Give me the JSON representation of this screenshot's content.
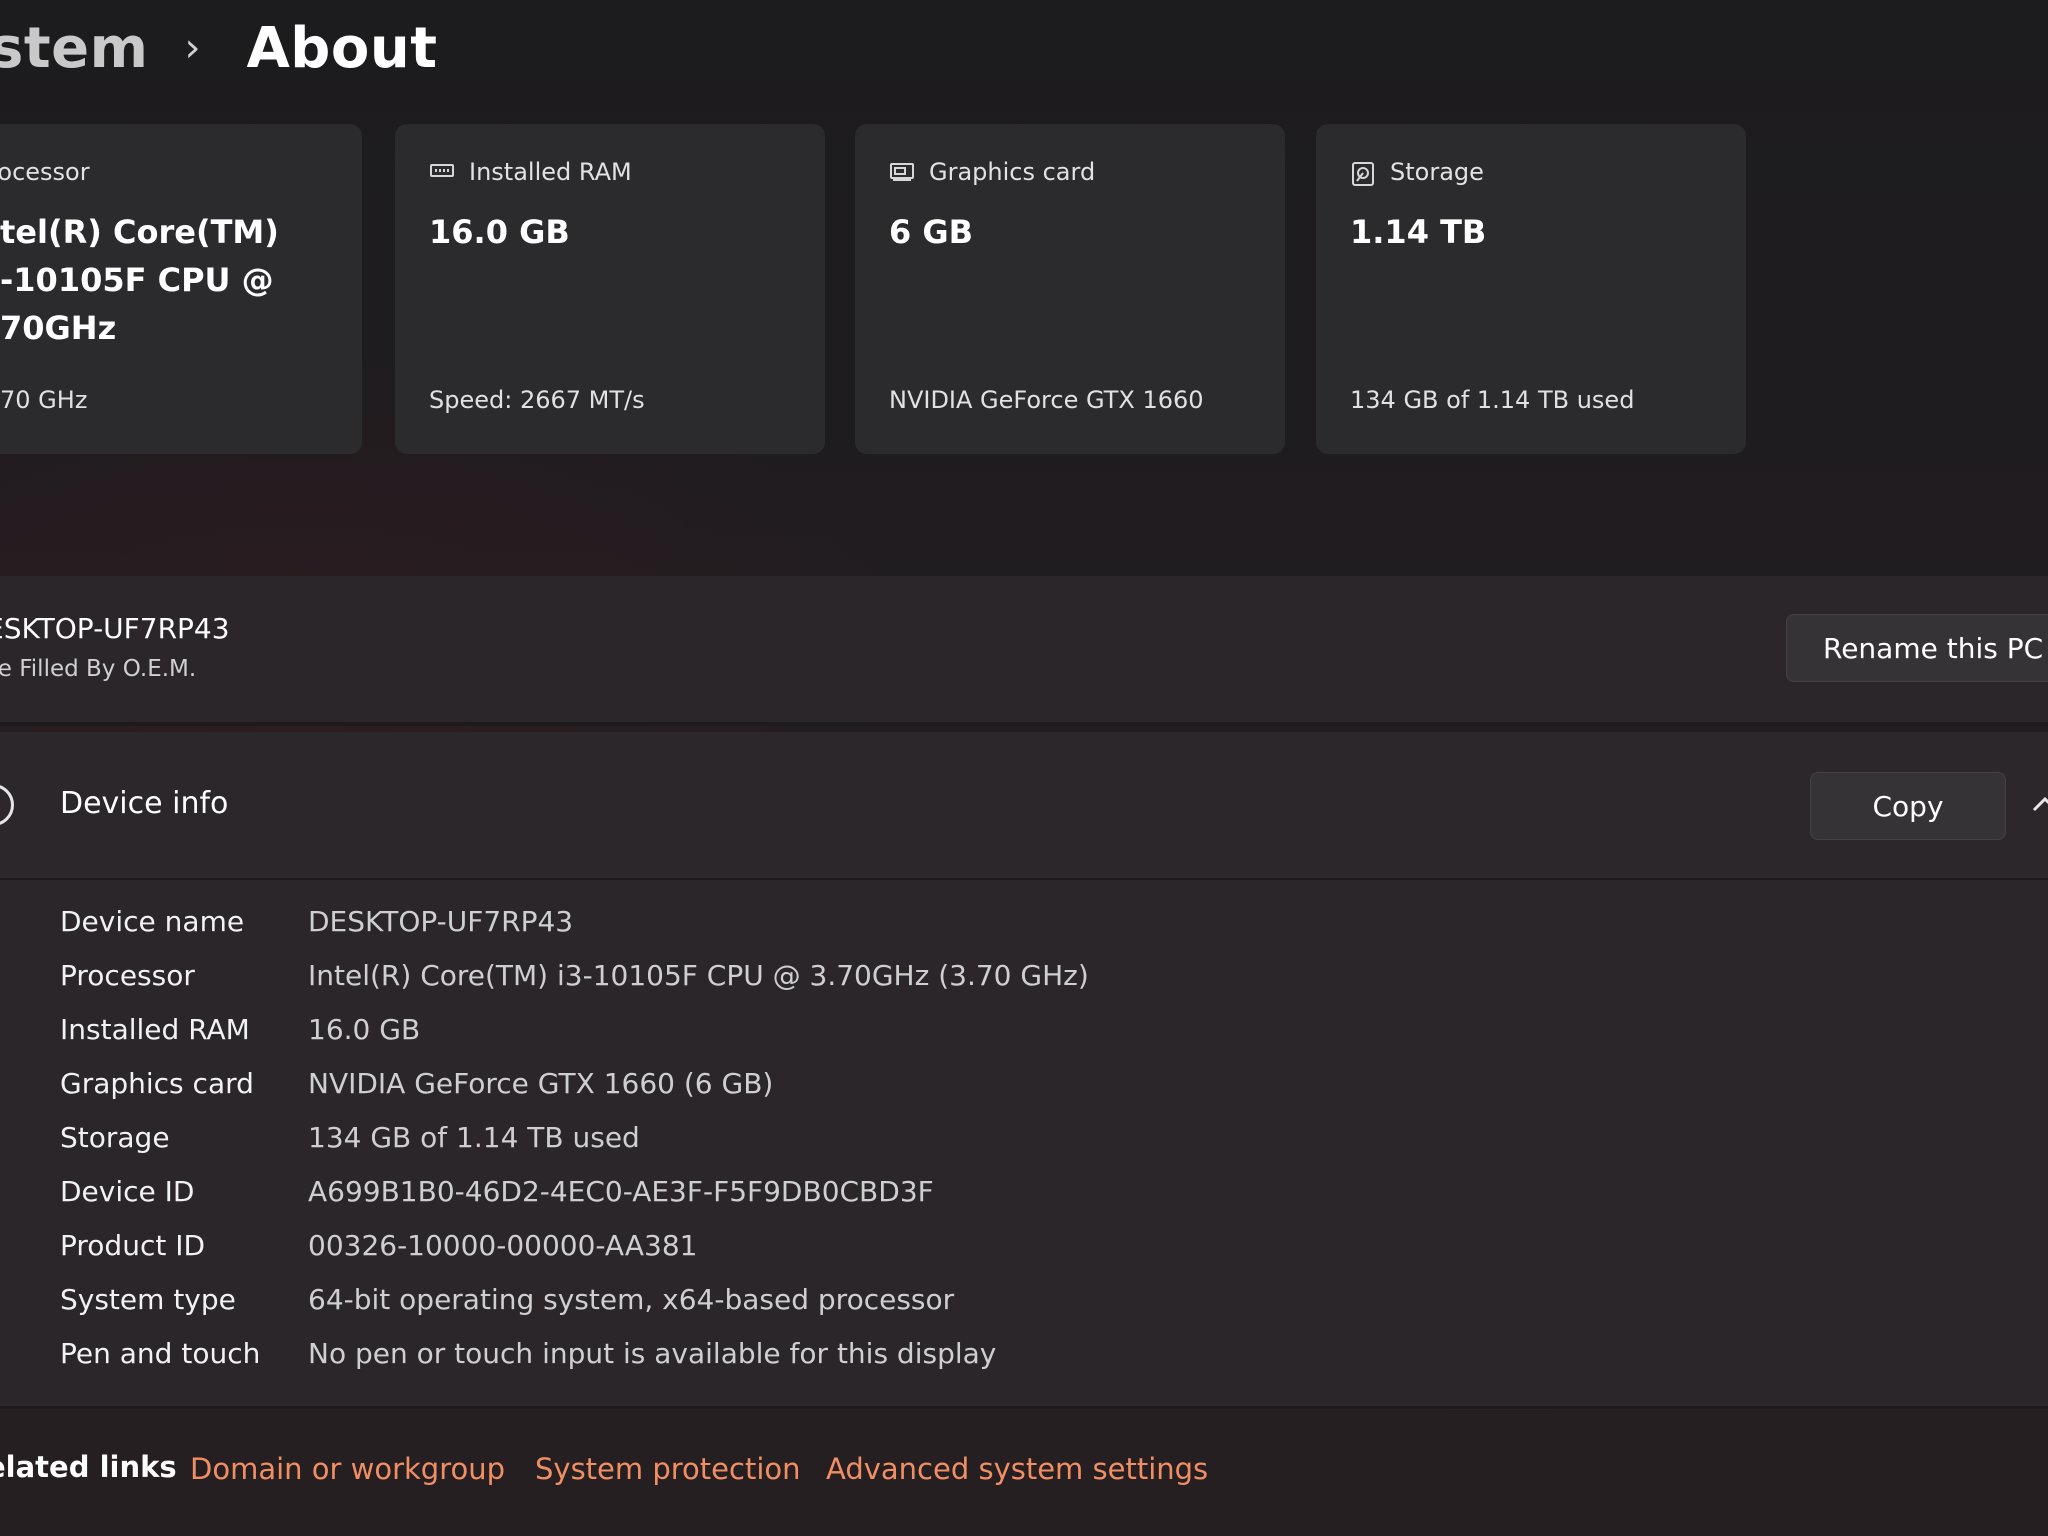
{
  "breadcrumb": {
    "parent": "stem",
    "separator": "›",
    "current": "About"
  },
  "specs": [
    {
      "icon": "processor-icon",
      "label": "Processor",
      "value": "tel(R) Core(TM)\n-10105F CPU @\n70GHz",
      "sub": "70 GHz"
    },
    {
      "icon": "ram-icon",
      "label": "Installed RAM",
      "value": "16.0 GB",
      "sub": "Speed: 2667 MT/s"
    },
    {
      "icon": "graphics-card-icon",
      "label": "Graphics card",
      "value": "6 GB",
      "sub": "NVIDIA GeForce GTX 1660"
    },
    {
      "icon": "storage-icon",
      "label": "Storage",
      "value": "1.14 TB",
      "sub": "134 GB of 1.14 TB used"
    }
  ],
  "rename": {
    "pc_name": "ESKTOP-UF7RP43",
    "model": "Be Filled By O.E.M.",
    "button": "Rename this PC"
  },
  "device_info": {
    "title": "Device info",
    "copy_button": "Copy",
    "rows": [
      {
        "label": "Device name",
        "value": "DESKTOP-UF7RP43"
      },
      {
        "label": "Processor",
        "value": "Intel(R) Core(TM) i3-10105F CPU @ 3.70GHz (3.70 GHz)"
      },
      {
        "label": "Installed RAM",
        "value": "16.0 GB"
      },
      {
        "label": "Graphics card",
        "value": "NVIDIA GeForce GTX 1660 (6 GB)"
      },
      {
        "label": "Storage",
        "value": "134 GB of 1.14 TB used"
      },
      {
        "label": "Device ID",
        "value": "A699B1B0-46D2-4EC0-AE3F-F5F9DB0CBD3F"
      },
      {
        "label": "Product ID",
        "value": "00326-10000-00000-AA381"
      },
      {
        "label": "System type",
        "value": "64-bit operating system, x64-based processor"
      },
      {
        "label": "Pen and touch",
        "value": "No pen or touch input is available for this display"
      }
    ]
  },
  "related_links": {
    "title": "elated links",
    "links": [
      "Domain or workgroup",
      "System protection",
      "Advanced system settings"
    ]
  },
  "colors": {
    "link": "#f08e64",
    "card": "#2b2a2d",
    "background": "#201e20"
  }
}
